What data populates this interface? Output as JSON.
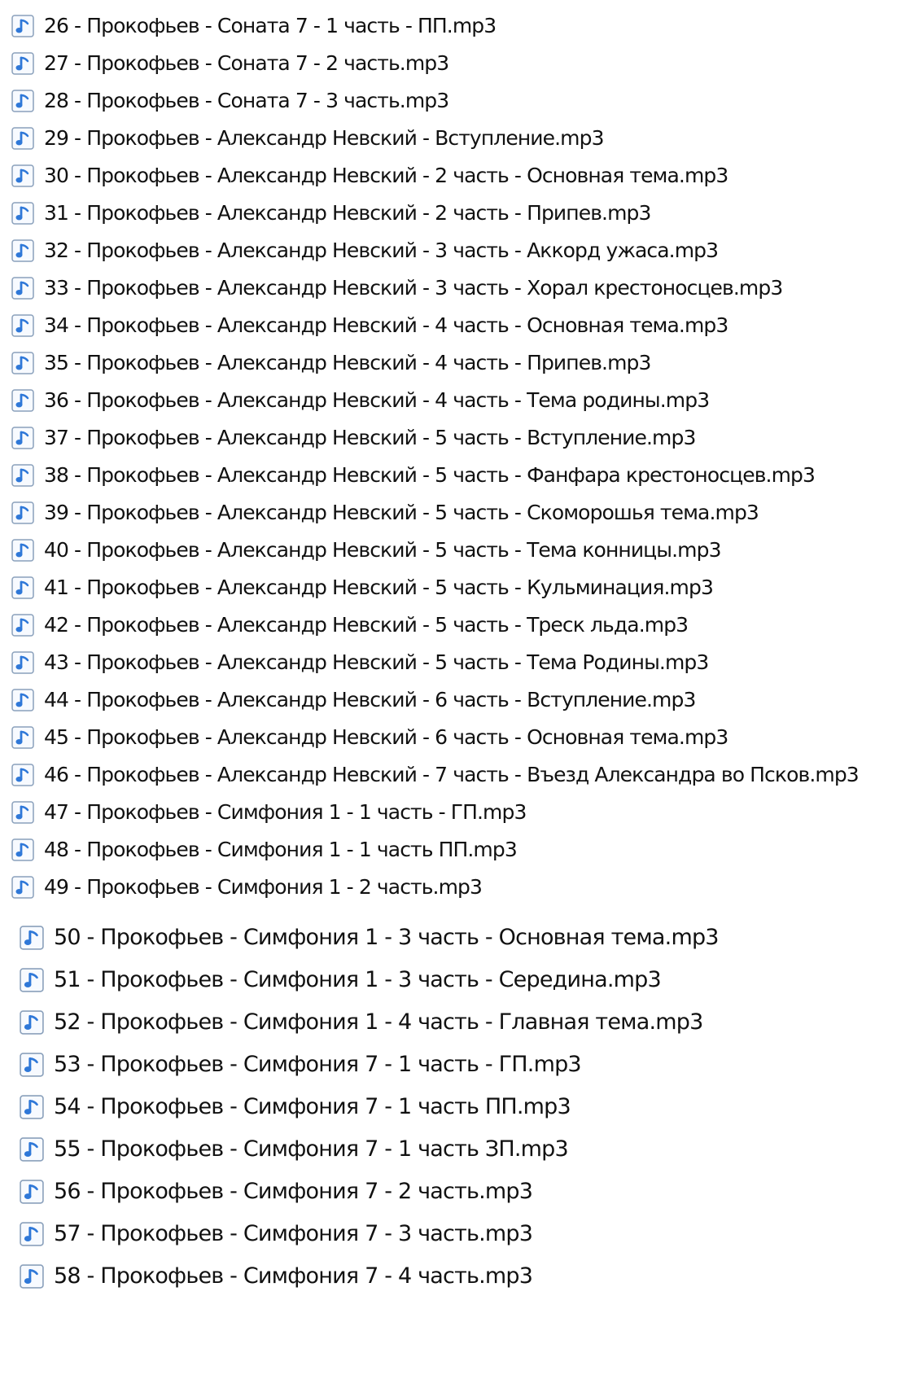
{
  "files": [
    "26 - Прокофьев - Соната 7 - 1 часть - ПП.mp3",
    "27 - Прокофьев - Соната 7 - 2 часть.mp3",
    "28 - Прокофьев - Соната 7 - 3 часть.mp3",
    "29 - Прокофьев - Александр Невский - Вступление.mp3",
    "30 - Прокофьев - Александр Невский - 2 часть - Основная тема.mp3",
    "31 - Прокофьев - Александр Невский - 2 часть - Припев.mp3",
    "32 - Прокофьев - Александр Невский - 3 часть - Аккорд ужаса.mp3",
    "33 - Прокофьев - Александр Невский - 3 часть - Хорал крестоносцев.mp3",
    "34 - Прокофьев - Александр Невский - 4 часть - Основная тема.mp3",
    "35 - Прокофьев - Александр Невский - 4 часть - Припев.mp3",
    "36 - Прокофьев - Александр Невский - 4 часть - Тема родины.mp3",
    "37 - Прокофьев - Александр Невский - 5 часть - Вступление.mp3",
    "38 - Прокофьев - Александр Невский - 5 часть - Фанфара крестоносцев.mp3",
    "39 - Прокофьев - Александр Невский - 5 часть - Скоморошья тема.mp3",
    "40 - Прокофьев - Александр Невский - 5 часть - Тема конницы.mp3",
    "41 - Прокофьев - Александр Невский - 5 часть - Кульминация.mp3",
    "42 - Прокофьев - Александр Невский - 5 часть - Треск льда.mp3",
    "43 - Прокофьев - Александр Невский - 5 часть - Тема Родины.mp3",
    "44 - Прокофьев - Александр Невский - 6 часть - Вступление.mp3",
    "45 - Прокофьев - Александр Невский - 6 часть - Основная тема.mp3",
    "46 - Прокофьев - Александр Невский - 7 часть - Въезд Александра во Псков.mp3",
    "47 - Прокофьев - Симфония 1 - 1 часть - ГП.mp3",
    "48 - Прокофьев - Симфония 1 - 1 часть ПП.mp3",
    "49 - Прокофьев - Симфония 1 - 2 часть.mp3",
    "50 - Прокофьев - Симфония 1 - 3 часть - Основная тема.mp3",
    "51 - Прокофьев - Симфония 1 - 3 часть - Середина.mp3",
    "52 - Прокофьев - Симфония 1 - 4 часть - Главная тема.mp3",
    "53 - Прокофьев - Симфония 7 - 1 часть - ГП.mp3",
    "54 - Прокофьев - Симфония 7 - 1 часть ПП.mp3",
    "55 - Прокофьев - Симфония 7 - 1 часть ЗП.mp3",
    "56 - Прокофьев - Симфония 7 - 2 часть.mp3",
    "57 - Прокофьев - Симфония 7 - 3 часть.mp3",
    "58 - Прокофьев - Симфония 7 - 4 часть.mp3"
  ],
  "icon": "audio-file-icon",
  "colors": {
    "icon_blue": "#2f78d8",
    "icon_border": "#8aa0bb",
    "text": "#111111"
  }
}
